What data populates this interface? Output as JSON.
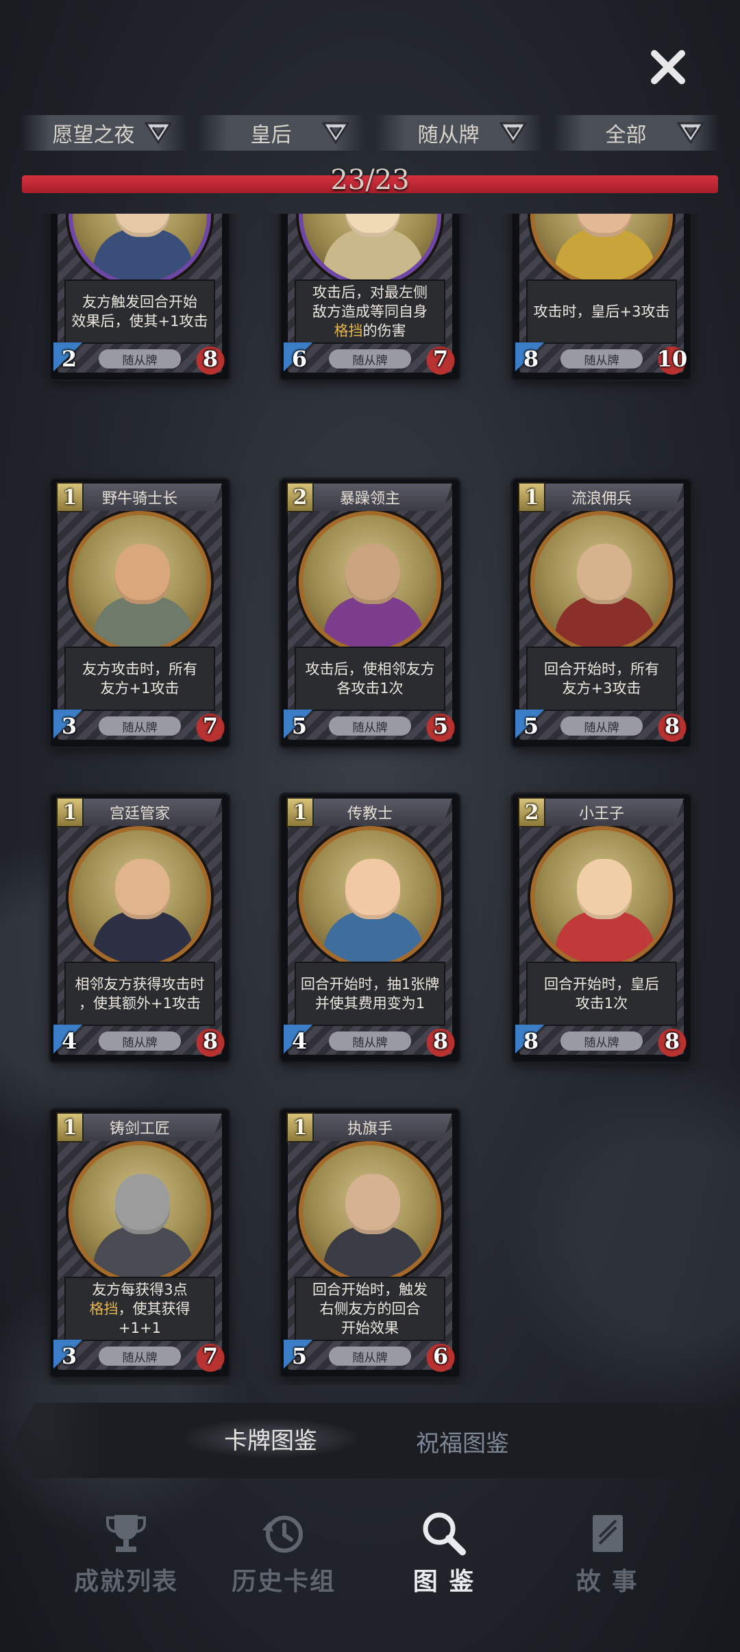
{
  "filters": [
    {
      "label": "愿望之夜"
    },
    {
      "label": "皇后"
    },
    {
      "label": "随从牌"
    },
    {
      "label": "全部"
    }
  ],
  "progress": {
    "text": "23/23",
    "collected": 23,
    "total": 23
  },
  "cards": [
    {
      "name": "",
      "cost": "",
      "desc1": "友方触发回合开始",
      "desc2": "效果后，使其+1攻击",
      "desc3": "",
      "attack": "2",
      "health": "8",
      "type": "随从牌"
    },
    {
      "name": "",
      "cost": "",
      "desc1": "攻击后，对最左侧",
      "desc2": "敌方造成等同自身",
      "desc3": "格挡",
      "desc3b": "的伤害",
      "attack": "6",
      "health": "7",
      "type": "随从牌"
    },
    {
      "name": "",
      "cost": "",
      "desc1": "攻击时，皇后+3攻击",
      "desc2": "",
      "desc3": "",
      "attack": "8",
      "health": "10",
      "type": "随从牌"
    },
    {
      "name": "野牛骑士长",
      "cost": "1",
      "desc1": "友方攻击时，所有",
      "desc2": "友方+1攻击",
      "desc3": "",
      "attack": "3",
      "health": "7",
      "type": "随从牌"
    },
    {
      "name": "暴躁领主",
      "cost": "2",
      "desc1": "攻击后，使相邻友方",
      "desc2": "各攻击1次",
      "desc3": "",
      "attack": "5",
      "health": "5",
      "type": "随从牌"
    },
    {
      "name": "流浪佣兵",
      "cost": "1",
      "desc1": "回合开始时，所有",
      "desc2": "友方+3攻击",
      "desc3": "",
      "attack": "5",
      "health": "8",
      "type": "随从牌"
    },
    {
      "name": "宫廷管家",
      "cost": "1",
      "desc1": "相邻友方获得攻击时",
      "desc2": "，使其额外+1攻击",
      "desc3": "",
      "attack": "4",
      "health": "8",
      "type": "随从牌"
    },
    {
      "name": "传教士",
      "cost": "1",
      "desc1": "回合开始时，抽1张牌",
      "desc2": "并使其费用变为1",
      "desc3": "",
      "attack": "4",
      "health": "8",
      "type": "随从牌"
    },
    {
      "name": "小王子",
      "cost": "2",
      "desc1": "回合开始时，皇后",
      "desc2": "攻击1次",
      "desc3": "",
      "attack": "8",
      "health": "8",
      "type": "随从牌"
    },
    {
      "name": "铸剑工匠",
      "cost": "1",
      "desc1": "友方每获得3点",
      "desc2hl": "格挡",
      "desc2": "，使其获得+1+1",
      "desc3": "",
      "attack": "3",
      "health": "7",
      "type": "随从牌"
    },
    {
      "name": "执旗手",
      "cost": "1",
      "desc1": "回合开始时，触发",
      "desc2": "右侧友方的回合",
      "desc3": "开始效果",
      "attack": "5",
      "health": "6",
      "type": "随从牌"
    }
  ],
  "tabs": {
    "cards": "卡牌图鉴",
    "blessings": "祝福图鉴"
  },
  "nav": {
    "achievements": "成就列表",
    "history": "历史卡组",
    "codex": "图 鉴",
    "story": "故 事"
  },
  "colors": {
    "accent_red": "#c62a36",
    "highlight_gold": "#e5b54a",
    "attack_blue": "#3b7ec7",
    "health_red": "#b83232"
  }
}
